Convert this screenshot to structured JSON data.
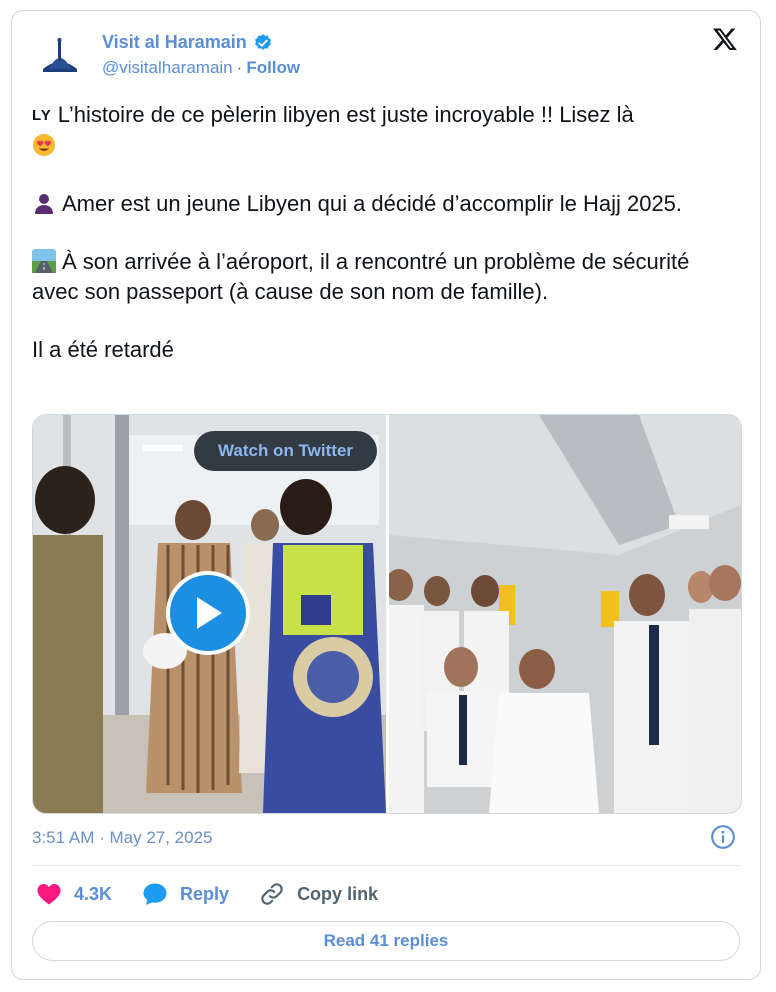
{
  "author": {
    "name": "Visit al Haramain",
    "handle": "@visitalharamain",
    "separator": "·",
    "follow_label": "Follow"
  },
  "tweet": {
    "line1_flag": "LY",
    "line1": "L’histoire de ce pèlerin libyen est juste incroyable !! Lisez là",
    "line2": "Amer est un jeune Libyen qui a décidé d’accomplir le Hajj 2025.",
    "line3": "À son arrivée à l’aéroport, il a rencontré un problème de sécurité avec son passeport (à cause de son nom de famille).",
    "line4": "Il a été retardé"
  },
  "media": {
    "watch_label": "Watch on Twitter"
  },
  "meta": {
    "timestamp": "3:51 AM · May 27, 2025"
  },
  "actions": {
    "likes": "4.3K",
    "reply_label": "Reply",
    "copy_label": "Copy link"
  },
  "footer": {
    "read_replies_label": "Read 41 replies"
  },
  "colors": {
    "accent": "#5b8ed6",
    "like": "#f91880",
    "verified": "#1d9bf0"
  },
  "icons": [
    "verified-badge-icon",
    "x-logo-icon",
    "heart-icon",
    "reply-bubble-icon",
    "link-icon",
    "info-icon",
    "play-icon"
  ]
}
